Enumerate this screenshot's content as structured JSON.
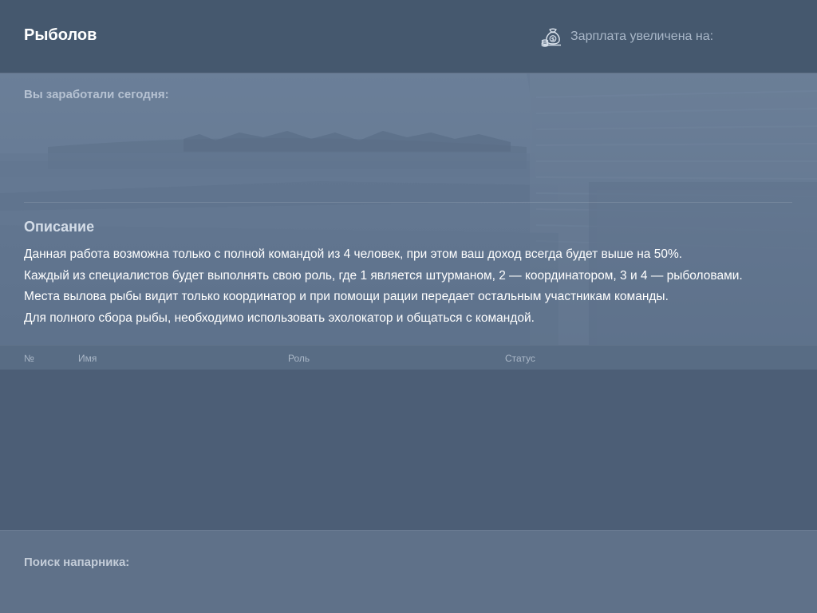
{
  "header": {
    "title": "Рыболов",
    "salary_label": "Зарплата увеличена на:",
    "salary_icon": "money-bag-icon"
  },
  "hero": {
    "earned_label": "Вы заработали сегодня:",
    "description_heading": "Описание",
    "description_lines": [
      "Данная работа возможна только с полной командой из 4 человек, при этом ваш доход всегда будет выше на 50%.",
      "Каждый из специалистов будет выполнять свою роль, где 1 является штурманом, 2 — координатором, 3 и 4 — рыболовами.",
      "Места вылова рыбы видит только координатор и при помощи рации передает остальным участникам команды.",
      "Для полного сбора рыбы, необходимо использовать эхолокатор и общаться с командой."
    ]
  },
  "team_table": {
    "columns": [
      "№",
      "Имя",
      "Роль",
      "Статус"
    ],
    "rows": []
  },
  "footer": {
    "partner_search_label": "Поиск напарника:"
  },
  "colors": {
    "header_bg": "#45586e",
    "panel_bg": "#4c5e76",
    "hero_bg": "#657993",
    "footer_bg": "#5f7189"
  }
}
